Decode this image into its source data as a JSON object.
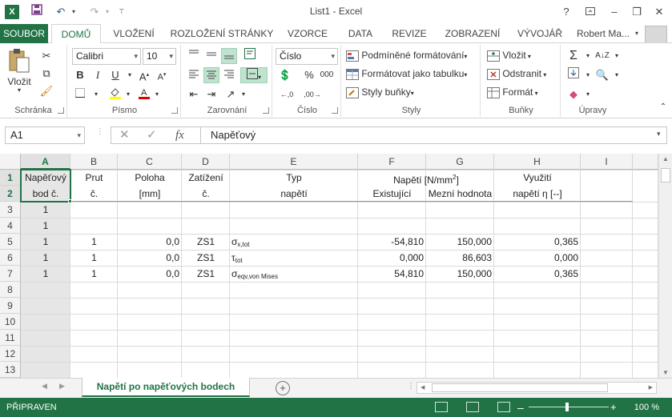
{
  "window": {
    "title": "List1 - Excel",
    "help": "?",
    "user": "Robert Ma..."
  },
  "quick_access": {
    "logo": "X",
    "save_icon": "save-icon",
    "undo_icon": "undo-icon",
    "redo_icon": "redo-icon"
  },
  "tabs": [
    "SOUBOR",
    "DOMŮ",
    "VLOŽENÍ",
    "ROZLOŽENÍ STRÁNKY",
    "VZORCE",
    "DATA",
    "REVIZE",
    "ZOBRAZENÍ",
    "VÝVOJÁŘ"
  ],
  "ribbon": {
    "clipboard": {
      "label": "Schránka",
      "paste": "Vložit"
    },
    "font": {
      "label": "Písmo",
      "name": "Calibri",
      "size": "10",
      "bold": "B",
      "italic": "I",
      "underline": "U"
    },
    "alignment": {
      "label": "Zarovnání"
    },
    "number": {
      "label": "Číslo",
      "format": "Číslo",
      "percent": "%",
      "thousands": "000"
    },
    "styles": {
      "label": "Styly",
      "conditional": "Podmíněné formátování",
      "as_table": "Formátovat jako tabulku",
      "cell_styles": "Styly buňky"
    },
    "cells": {
      "label": "Buňky",
      "insert": "Vložit",
      "delete": "Odstranit",
      "format": "Formát"
    },
    "editing": {
      "label": "Úpravy"
    }
  },
  "formula_bar": {
    "name_box": "A1",
    "fx": "fx",
    "formula": "Napěťový"
  },
  "columns": [
    "A",
    "B",
    "C",
    "D",
    "E",
    "F",
    "G",
    "H",
    "I"
  ],
  "rows": [
    "1",
    "2",
    "3",
    "4",
    "5",
    "6",
    "7",
    "8",
    "9",
    "10",
    "11",
    "12",
    "13"
  ],
  "header": {
    "a1": "Napěťový",
    "a2": "bod č.",
    "b1": "Prut",
    "b2": "č.",
    "c1": "Poloha",
    "c2": "[mm]",
    "d1": "Zatížení",
    "d2": "č.",
    "e1": "Typ",
    "e2": "napětí",
    "fg1": "Napětí [N/mm",
    "fg1_sup": "2",
    "fg1_end": "]",
    "f2": "Existující",
    "g2": "Mezní hodnota",
    "h1": "Využití",
    "h2": "napětí η [--]"
  },
  "data_rows": [
    {
      "a": "1",
      "b": "",
      "c": "",
      "d": "",
      "e": "",
      "e_sub": "",
      "f": "",
      "g": "",
      "h": ""
    },
    {
      "a": "1",
      "b": "",
      "c": "",
      "d": "",
      "e": "",
      "e_sub": "",
      "f": "",
      "g": "",
      "h": ""
    },
    {
      "a": "1",
      "b": "1",
      "c": "0,0",
      "d": "ZS1",
      "e": "σ",
      "e_sub": "x,tot",
      "f": "-54,810",
      "g": "150,000",
      "h": "0,365"
    },
    {
      "a": "1",
      "b": "1",
      "c": "0,0",
      "d": "ZS1",
      "e": "τ",
      "e_sub": "tot",
      "f": "0,000",
      "g": "86,603",
      "h": "0,000"
    },
    {
      "a": "1",
      "b": "1",
      "c": "0,0",
      "d": "ZS1",
      "e": "σ",
      "e_sub": "eqv,von Mises",
      "f": "54,810",
      "g": "150,000",
      "h": "0,365"
    }
  ],
  "sheet_tab": "Napětí po napěťových bodech",
  "status": {
    "ready": "PŘIPRAVEN",
    "zoom": "100 %"
  },
  "colors": {
    "excel_green": "#217346"
  }
}
